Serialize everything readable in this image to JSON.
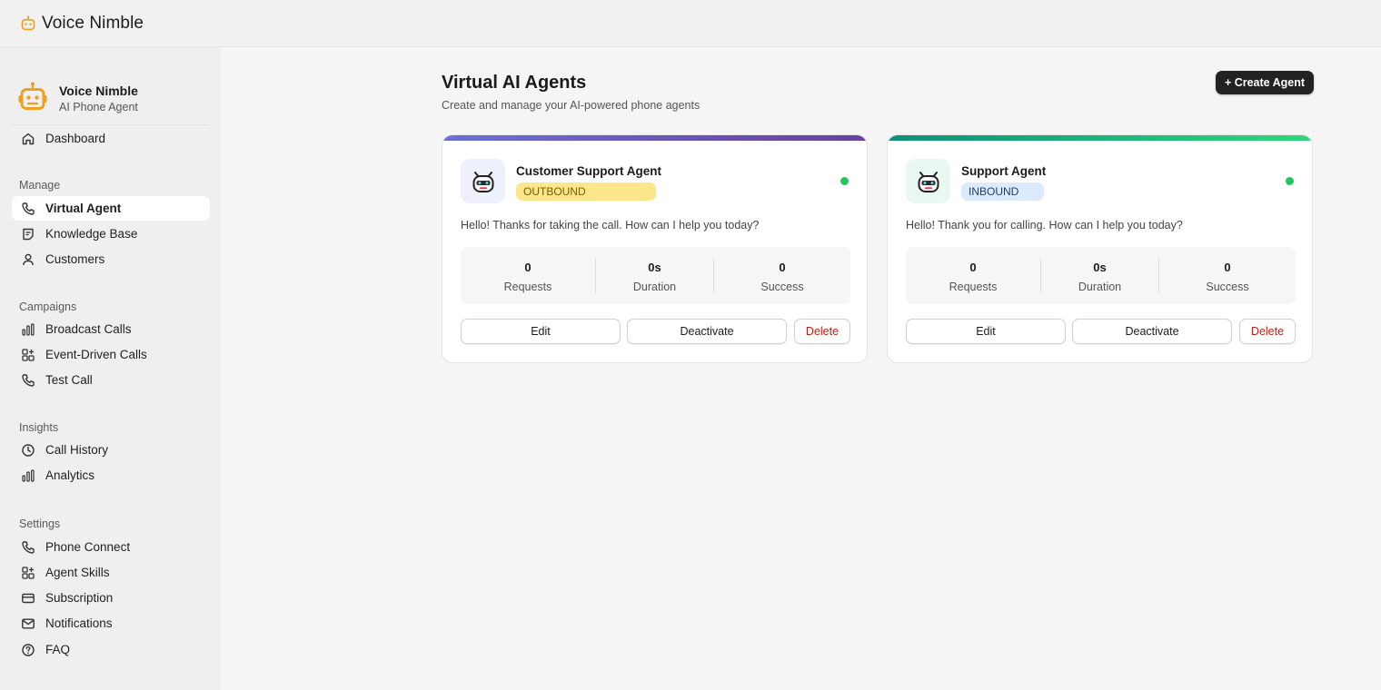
{
  "app": {
    "title": "Voice Nimble"
  },
  "sidebar": {
    "brand_name": "Voice Nimble",
    "brand_sub": "AI Phone Agent",
    "dashboard": "Dashboard",
    "sections": {
      "manage": "Manage",
      "campaigns": "Campaigns",
      "insights": "Insights",
      "settings": "Settings"
    },
    "items": {
      "virtual_agent": "Virtual Agent",
      "knowledge_base": "Knowledge Base",
      "customers": "Customers",
      "broadcast_calls": "Broadcast Calls",
      "event_driven_calls": "Event-Driven Calls",
      "test_call": "Test Call",
      "call_history": "Call History",
      "analytics": "Analytics",
      "phone_connect": "Phone Connect",
      "agent_skills": "Agent Skills",
      "subscription": "Subscription",
      "notifications": "Notifications",
      "faq": "FAQ"
    },
    "active_item": "Virtual Agent"
  },
  "main": {
    "title": "Virtual AI Agents",
    "subtitle": "Create and manage your AI-powered phone agents",
    "create_button": "+ Create Agent"
  },
  "agents": [
    {
      "name": "Customer Support Agent",
      "direction": "OUTBOUND",
      "greeting": "Hello! Thanks for taking the call. How can I help you today?",
      "status": "active",
      "stats": {
        "requests_value": "0",
        "requests_label": "Requests",
        "duration_value": "0s",
        "duration_label": "Duration",
        "success_value": "0",
        "success_label": "Success"
      },
      "buttons": {
        "edit": "Edit",
        "deactivate": "Deactivate",
        "delete": "Delete"
      },
      "colors": {
        "bar_start": "#6b6fd6",
        "bar_end": "#6a3fa0",
        "badge_bg": "#fde68a",
        "badge_text": "#7a5a00",
        "avatar_bg": "#eef0fb",
        "status": "#22c55e"
      }
    },
    {
      "name": "Support Agent",
      "direction": "INBOUND",
      "greeting": "Hello! Thank you for calling. How can I help you today?",
      "status": "active",
      "stats": {
        "requests_value": "0",
        "requests_label": "Requests",
        "duration_value": "0s",
        "duration_label": "Duration",
        "success_value": "0",
        "success_label": "Success"
      },
      "buttons": {
        "edit": "Edit",
        "deactivate": "Deactivate",
        "delete": "Delete"
      },
      "colors": {
        "bar_start": "#0e8f7a",
        "bar_end": "#2fd87a",
        "badge_bg": "#dbeafe",
        "badge_text": "#1e3a5f",
        "avatar_bg": "#e9f8f1",
        "status": "#22c55e"
      }
    }
  ],
  "colors": {
    "brand_orange": "#f0a020",
    "create_button_bg": "#222222",
    "delete_text": "#b42318"
  }
}
